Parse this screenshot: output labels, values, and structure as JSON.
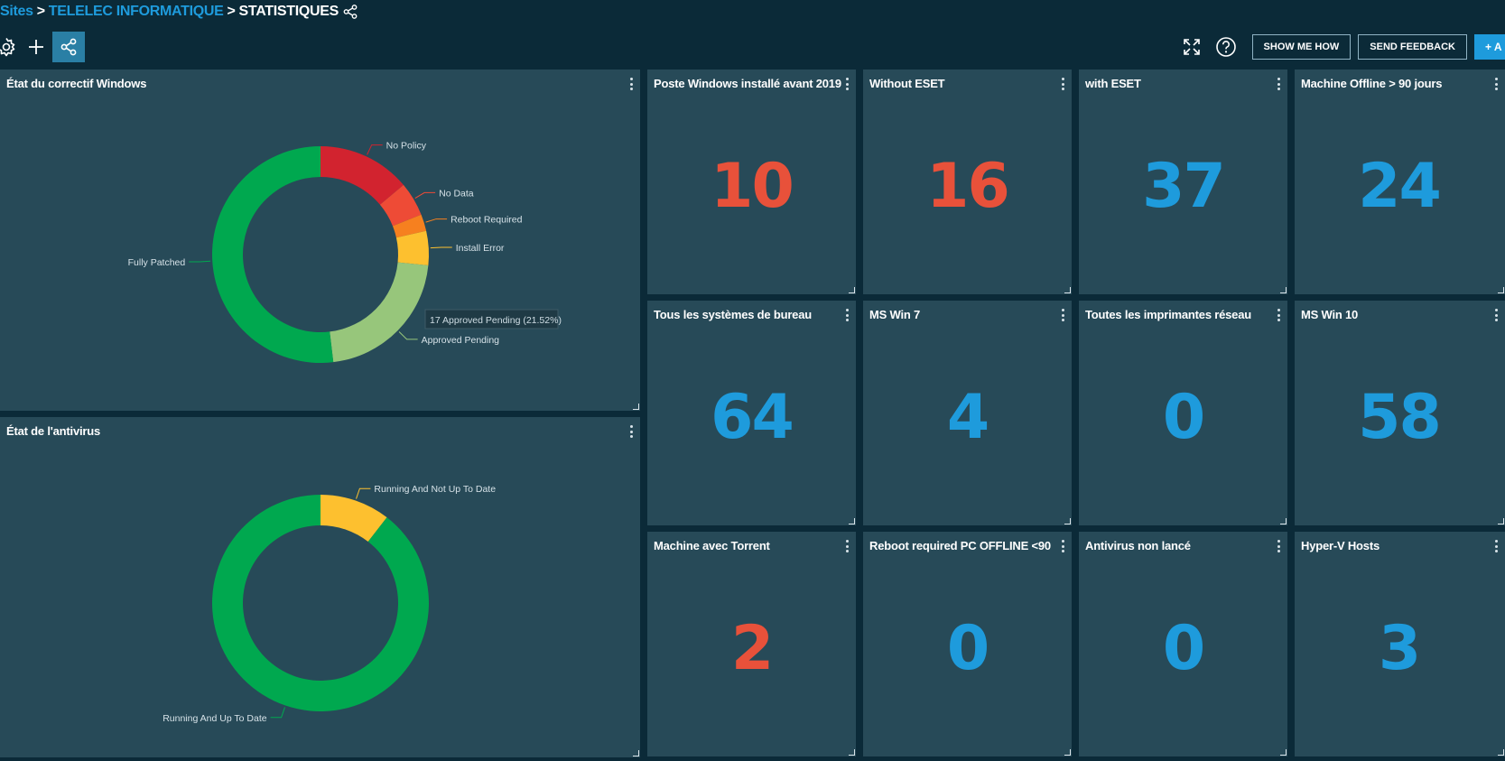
{
  "breadcrumb": {
    "sites": "Sites",
    "separator": ">",
    "site": "TELELEC INFORMATIQUE",
    "current": "STATISTIQUES"
  },
  "toolbar": {
    "show_me_how": "SHOW ME HOW",
    "send_feedback": "SEND FEEDBACK",
    "add_label": "+ A"
  },
  "colors": {
    "accent": "#1e9bdc",
    "danger": "#e8513a",
    "panel": "#274a58",
    "background": "#0b2a38"
  },
  "panels": {
    "patch": {
      "title": "État du correctif Windows"
    },
    "antivirus": {
      "title": "État de l'antivirus"
    }
  },
  "chart_data": [
    {
      "type": "pie",
      "title": "État du correctif Windows",
      "series": [
        {
          "name": "No Policy",
          "value": 13.9,
          "color": "#d2232f"
        },
        {
          "name": "No Data",
          "value": 5.1,
          "color": "#ee4b36"
        },
        {
          "name": "Reboot Required",
          "value": 2.5,
          "color": "#f6801f"
        },
        {
          "name": "Install Error",
          "value": 5.1,
          "color": "#fdc02f"
        },
        {
          "name": "Approved Pending",
          "value": 21.52,
          "color": "#97c67b"
        },
        {
          "name": "Fully Patched",
          "value": 51.9,
          "color": "#00a84f"
        }
      ],
      "tooltip": "17 Approved Pending (21.52%)"
    },
    {
      "type": "pie",
      "title": "État de l'antivirus",
      "series": [
        {
          "name": "Running And Not Up To Date",
          "value": 10.5,
          "color": "#fdc02f"
        },
        {
          "name": "Running And Up To Date",
          "value": 89.5,
          "color": "#00a84f"
        }
      ]
    }
  ],
  "tiles": [
    {
      "title": "Poste Windows installé avant 2019",
      "value": "10",
      "color": "#e8513a"
    },
    {
      "title": "Without ESET",
      "value": "16",
      "color": "#e8513a"
    },
    {
      "title": "with ESET",
      "value": "37",
      "color": "#1e9bdc"
    },
    {
      "title": "Machine Offline > 90 jours",
      "value": "24",
      "color": "#1e9bdc"
    },
    {
      "title": "Tous les systèmes de bureau",
      "value": "64",
      "color": "#1e9bdc"
    },
    {
      "title": "MS Win 7",
      "value": "4",
      "color": "#1e9bdc"
    },
    {
      "title": "Toutes les imprimantes réseau",
      "value": "0",
      "color": "#1e9bdc"
    },
    {
      "title": "MS Win 10",
      "value": "58",
      "color": "#1e9bdc"
    },
    {
      "title": "Machine avec Torrent",
      "value": "2",
      "color": "#e8513a"
    },
    {
      "title": "Reboot required PC OFFLINE <90",
      "value": "0",
      "color": "#1e9bdc"
    },
    {
      "title": "Antivirus non lancé",
      "value": "0",
      "color": "#1e9bdc"
    },
    {
      "title": "Hyper-V Hosts",
      "value": "3",
      "color": "#1e9bdc"
    }
  ]
}
